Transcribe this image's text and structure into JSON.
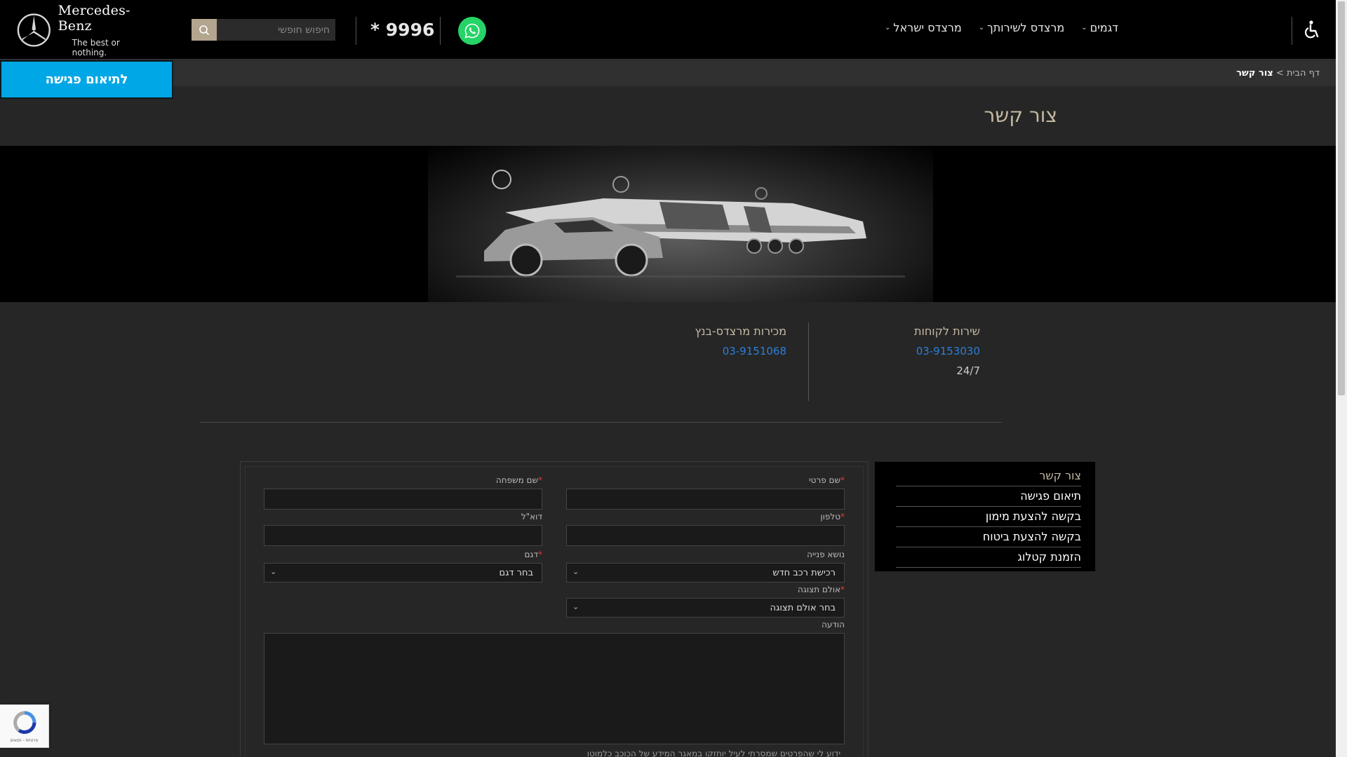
{
  "header": {
    "logo": {
      "brand": "Mercedes-Benz",
      "slogan": "The best or nothing."
    },
    "search": {
      "placeholder": "חיפוש חופשי",
      "icon": "search-icon"
    },
    "phone": "* 9996",
    "whatsapp_icon": "whatsapp-icon",
    "nav": [
      {
        "label": "דגמים",
        "has_dropdown": true
      },
      {
        "label": "מרצדס לשירותך",
        "has_dropdown": true
      },
      {
        "label": "מרצדס ישראל",
        "has_dropdown": true
      }
    ],
    "accessibility_icon": "wheelchair-icon"
  },
  "breadcrumb": {
    "home": "דף הבית",
    "separator": ">",
    "current": "צור קשר"
  },
  "cta": {
    "label": "לתיאום פגישה",
    "color": "#00a7e6"
  },
  "page_title": "צור קשר",
  "contact": {
    "customer_service": {
      "title": "שירות לקוחות",
      "phone": "03-9153030",
      "hours": "24/7"
    },
    "sales": {
      "title": "מכירות מרצדס-בנץ",
      "phone": "03-9151068"
    }
  },
  "side_menu": [
    {
      "label": "צור קשר",
      "active": true
    },
    {
      "label": "תיאום פגישה",
      "active": false
    },
    {
      "label": "בקשה להצעת מימון",
      "active": false
    },
    {
      "label": "בקשה להצעת ביטוח",
      "active": false
    },
    {
      "label": "הזמנת קטלוג",
      "active": false
    }
  ],
  "form": {
    "first_name": {
      "label": "שם פרטי",
      "required": true,
      "value": ""
    },
    "last_name": {
      "label": "שם משפחה",
      "required": true,
      "value": ""
    },
    "phone": {
      "label": "טלפון",
      "required": true,
      "value": ""
    },
    "email": {
      "label": "דוא\"ל",
      "required": false,
      "value": ""
    },
    "subject": {
      "label": "נושא פנייה",
      "required": false,
      "value": "רכישת רכב חדש"
    },
    "model": {
      "label": "דגם",
      "required": true,
      "value": "בחר דגם"
    },
    "showroom": {
      "label": "אולם תצוגה",
      "required": true,
      "value": "בחר אולם תצוגה"
    },
    "message": {
      "label": "הודעה",
      "value": ""
    },
    "required_mark": "*"
  },
  "consent_text": "ידוע לי שהפרטים שמסרתי לעיל יוחזקו במאגר המידע של הכוכב כלמוטו",
  "recaptcha": {
    "text": "פרטיות - תנאים"
  },
  "colors": {
    "accent": "#00a7e6",
    "gold": "#c6b9a4",
    "link": "#2c7fd6",
    "whatsapp": "#25d366"
  }
}
